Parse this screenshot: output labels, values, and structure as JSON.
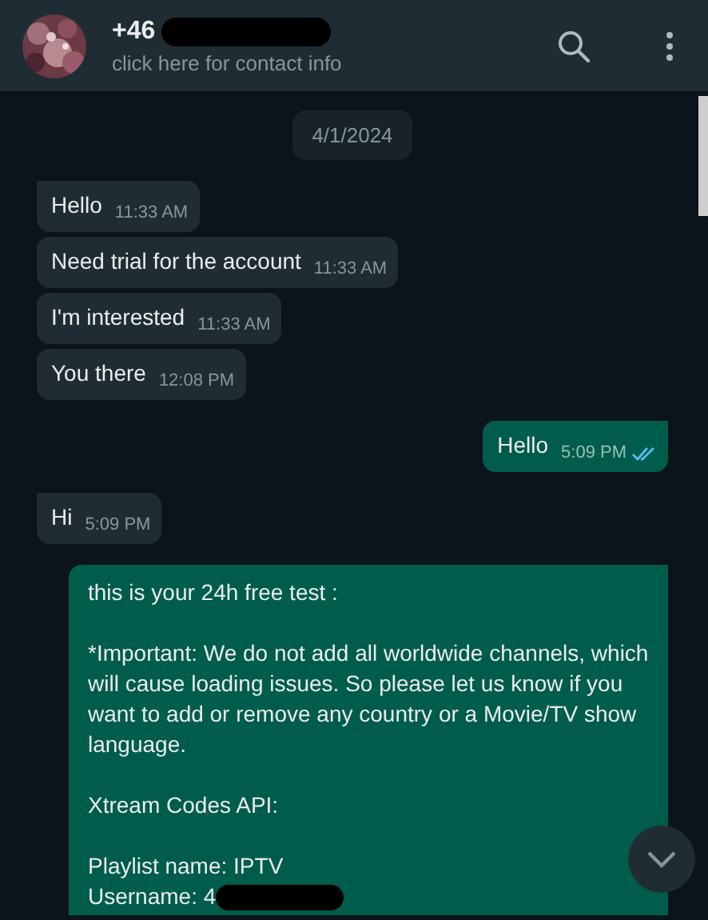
{
  "header": {
    "name": "+46",
    "name_redacted": true,
    "subtitle": "click here for contact info"
  },
  "date": "4/1/2024",
  "messages": [
    {
      "kind": "incoming",
      "tail": true,
      "text": "Hello",
      "time": "11:33 AM"
    },
    {
      "kind": "incoming",
      "tail": false,
      "text": "Need trial for the account",
      "time": "11:33 AM"
    },
    {
      "kind": "incoming",
      "tail": false,
      "text": "I'm interested",
      "time": "11:33 AM"
    },
    {
      "kind": "incoming",
      "tail": false,
      "text": "You there",
      "time": "12:08 PM"
    },
    {
      "kind": "outgoing",
      "tail": true,
      "text": "Hello",
      "time": "5:09 PM",
      "read": true
    },
    {
      "kind": "incoming",
      "tail": true,
      "text": "Hi",
      "time": "5:09 PM"
    },
    {
      "kind": "outgoing",
      "tail": true,
      "paragraphs": [
        {
          "lines": [
            {
              "text": "this is your 24h free test :",
              "redacted": false
            }
          ]
        },
        {
          "lines": [
            {
              "text": "*Important: We do not add all worldwide channels, which will cause loading issues. So please let us know if you want to add or remove any country or a Movie/TV show language.",
              "redacted": false
            }
          ]
        },
        {
          "lines": [
            {
              "text": "Xtream Codes API:",
              "redacted": false
            }
          ]
        },
        {
          "lines": [
            {
              "text": "Playlist name: IPTV",
              "redacted": false
            },
            {
              "text": "Username: 4",
              "redacted": true
            }
          ]
        }
      ]
    }
  ]
}
